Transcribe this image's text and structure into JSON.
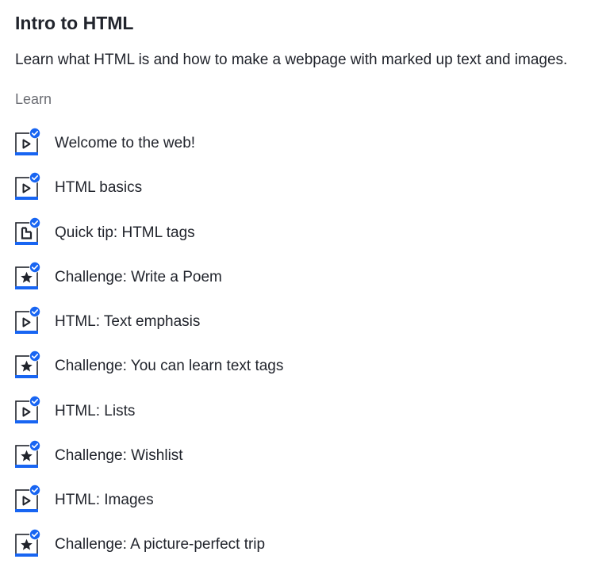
{
  "unit": {
    "title": "Intro to HTML",
    "description": "Learn what HTML is and how to make a webpage with marked up text and images."
  },
  "section": {
    "label": "Learn"
  },
  "colors": {
    "accent": "#1865f2",
    "text": "#21242c",
    "muted": "#6b6d73"
  },
  "lessons": [
    {
      "label": "Welcome to the web!",
      "icon": "video-icon",
      "completed": true
    },
    {
      "label": "HTML basics",
      "icon": "video-icon",
      "completed": true
    },
    {
      "label": "Quick tip: HTML tags",
      "icon": "article-icon",
      "completed": true
    },
    {
      "label": "Challenge: Write a Poem",
      "icon": "challenge-star-icon",
      "completed": true
    },
    {
      "label": "HTML: Text emphasis",
      "icon": "video-icon",
      "completed": true
    },
    {
      "label": "Challenge: You can learn text tags",
      "icon": "challenge-star-icon",
      "completed": true
    },
    {
      "label": "HTML: Lists",
      "icon": "video-icon",
      "completed": true
    },
    {
      "label": "Challenge: Wishlist",
      "icon": "challenge-star-icon",
      "completed": true
    },
    {
      "label": "HTML: Images",
      "icon": "video-icon",
      "completed": true
    },
    {
      "label": "Challenge: A picture-perfect trip",
      "icon": "challenge-star-icon",
      "completed": true
    }
  ]
}
